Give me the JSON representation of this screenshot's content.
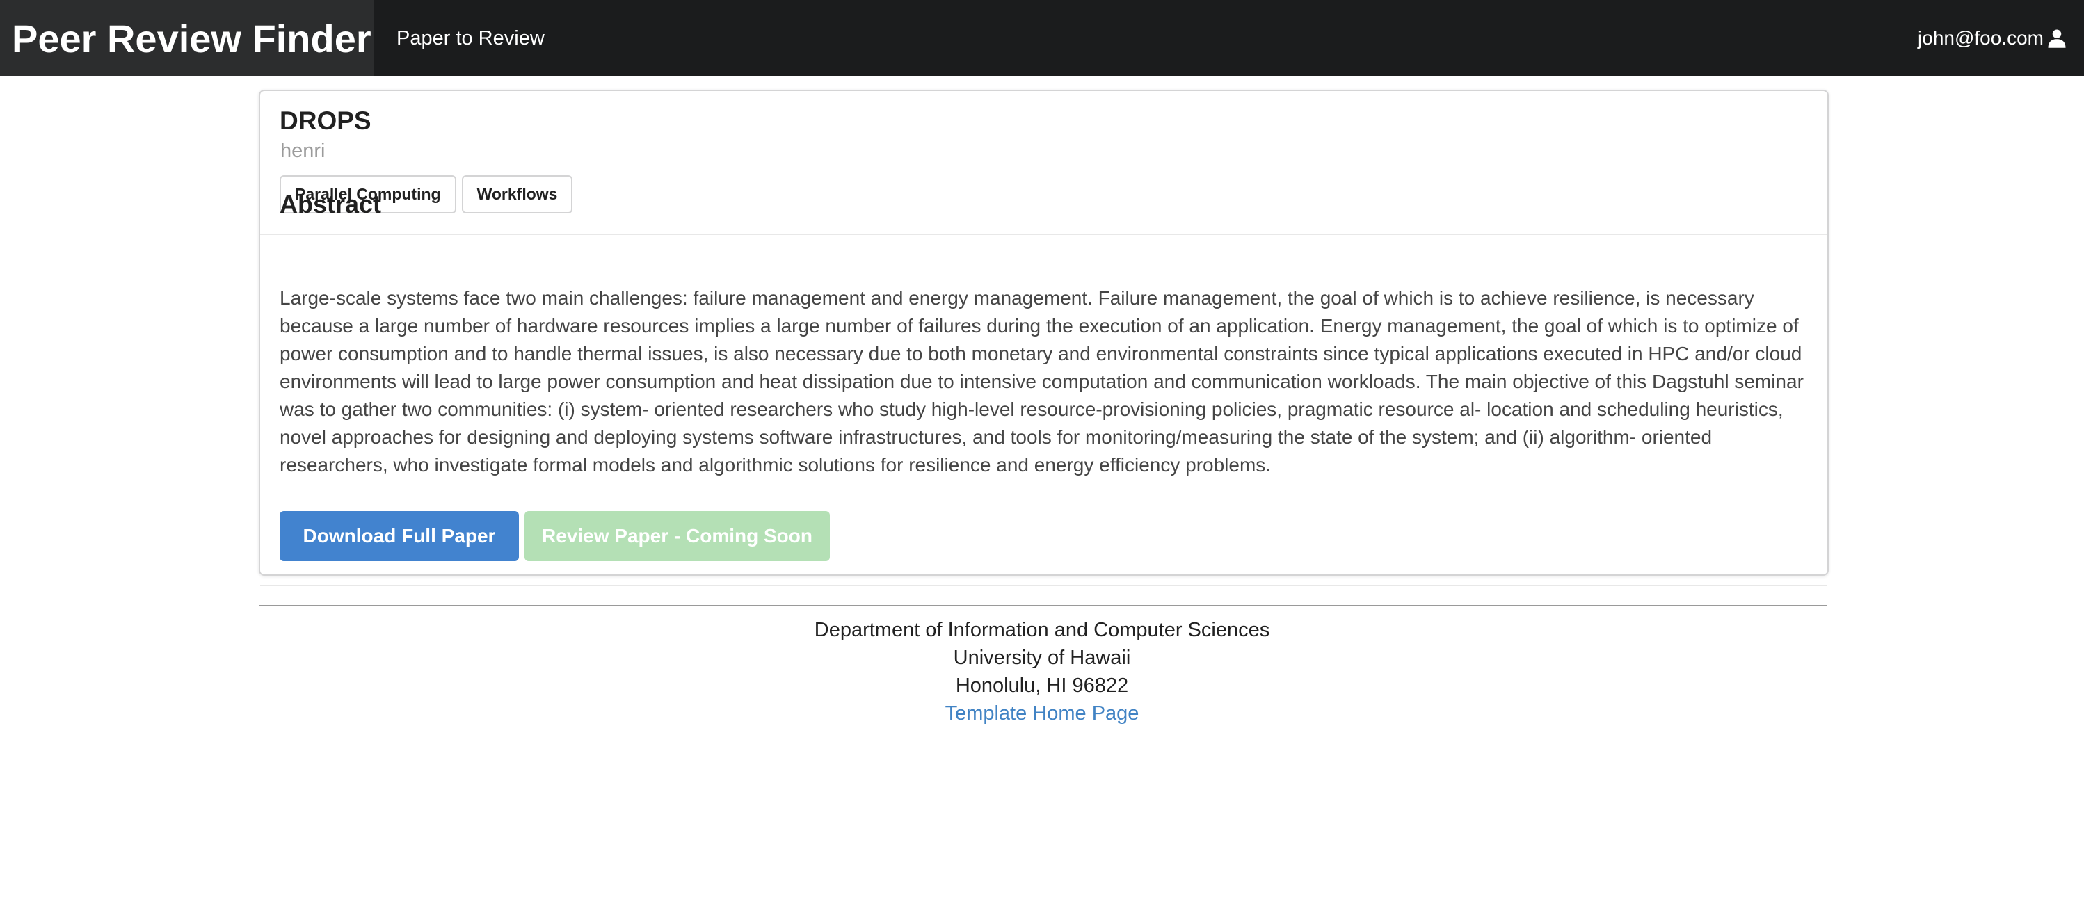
{
  "navbar": {
    "brand": "Peer Review Finder",
    "links": [
      {
        "label": "Paper to Review"
      }
    ],
    "user": {
      "email": "john@foo.com",
      "icon": "user-icon"
    }
  },
  "paper": {
    "title": "DROPS",
    "author": "henri",
    "tags": [
      "Parallel Computing",
      "Workflows"
    ],
    "abstract_heading": "Abstract",
    "abstract": "Large-scale systems face two main challenges: failure management and energy management. Failure management, the goal of which is to achieve resilience, is necessary because a large number of hardware resources implies a large number of failures during the execution of an application. Energy management, the goal of which is to optimize of power consumption and to handle thermal issues, is also necessary due to both monetary and environmental constraints since typical applications executed in HPC and/or cloud environments will lead to large power consumption and heat dissipation due to intensive computation and communication workloads. The main objective of this Dagstuhl seminar was to gather two communities: (i) system- oriented researchers who study high-level resource-provisioning policies, pragmatic resource al- location and scheduling heuristics, novel approaches for designing and deploying systems software infrastructures, and tools for monitoring/measuring the state of the system; and (ii) algorithm- oriented researchers, who investigate formal models and algorithmic solutions for resilience and energy efficiency problems.",
    "actions": {
      "download_label": "Download Full Paper",
      "review_label": "Review Paper - Coming Soon"
    }
  },
  "footer": {
    "department": "Department of Information and Computer Sciences",
    "university": "University of Hawaii",
    "location": "Honolulu, HI 96822",
    "link_label": "Template Home Page"
  },
  "colors": {
    "navbar_bg": "#1b1c1d",
    "brand_bg": "#2c2d2e",
    "primary_button": "#4283cf",
    "disabled_button": "#b4e0b5",
    "link": "#4183c4"
  }
}
